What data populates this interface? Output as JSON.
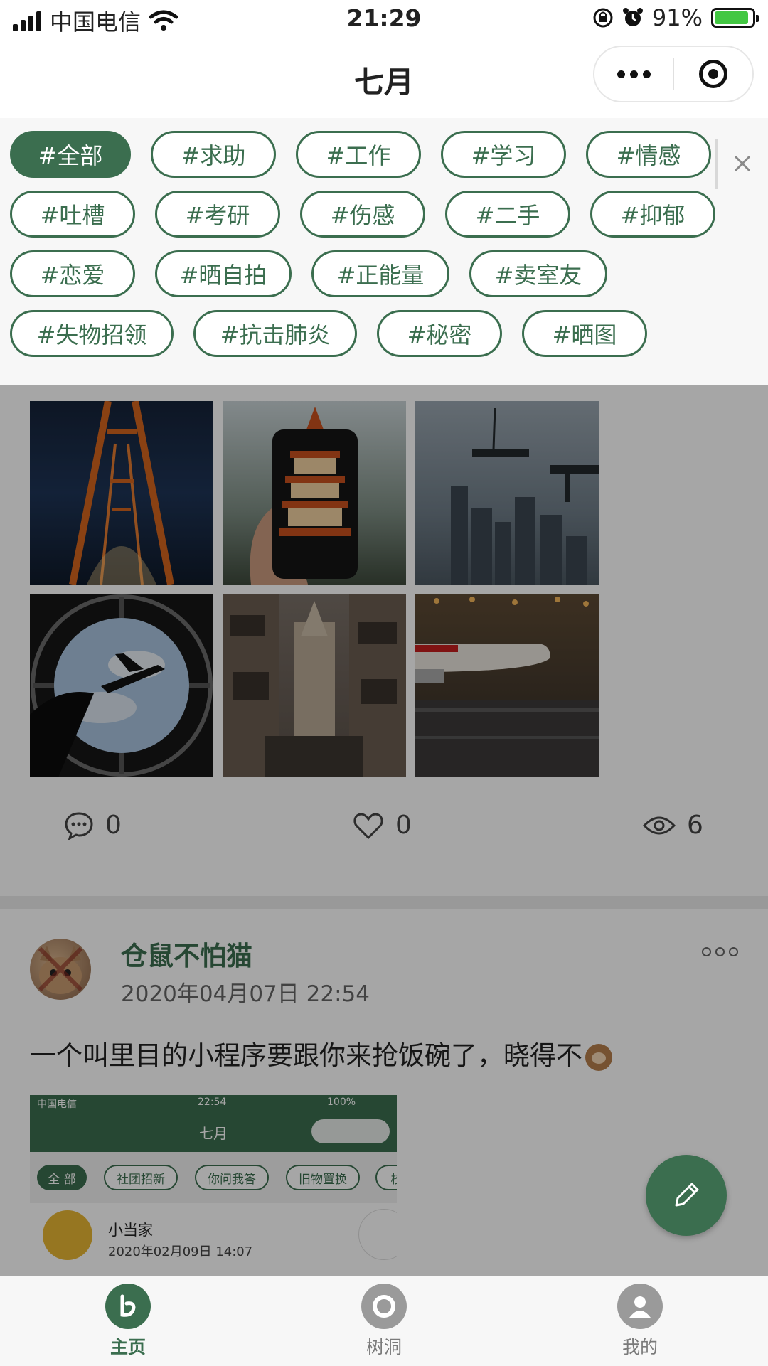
{
  "status_bar": {
    "carrier": "中国电信",
    "time": "21:29",
    "battery": "91%",
    "battery_level": 0.91
  },
  "nav": {
    "title": "七月"
  },
  "tags": [
    {
      "label": "#全部",
      "active": true
    },
    {
      "label": "#求助"
    },
    {
      "label": "#工作"
    },
    {
      "label": "#学习"
    },
    {
      "label": "#情感"
    },
    {
      "label": "#吐槽"
    },
    {
      "label": "#考研"
    },
    {
      "label": "#伤感"
    },
    {
      "label": "#二手"
    },
    {
      "label": "#抑郁"
    },
    {
      "label": "#恋爱"
    },
    {
      "label": "#晒自拍"
    },
    {
      "label": "#正能量"
    },
    {
      "label": "#卖室友"
    },
    {
      "label": "#失物招领"
    },
    {
      "label": "#抗击肺炎"
    },
    {
      "label": "#秘密"
    },
    {
      "label": "#晒图"
    }
  ],
  "post1": {
    "comments": "0",
    "likes": "0",
    "views": "6"
  },
  "post2": {
    "author": "仓鼠不怕猫",
    "time": "2020年04月07日 22:54",
    "text": "一个叫里目的小程序要跟你来抢饭碗了，晓得不",
    "screenshot": {
      "carrier": "中国电信",
      "time": "22:54",
      "battery": "100%",
      "title": "七月",
      "tags": [
        "全 部",
        "社团招新",
        "你问我答",
        "旧物置换",
        "校"
      ],
      "author": "小当家",
      "date": "2020年02月09日 14:07"
    }
  },
  "tabbar": [
    {
      "label": "主页",
      "active": true
    },
    {
      "label": "树洞"
    },
    {
      "label": "我的"
    }
  ],
  "colors": {
    "accent": "#3b6e4f",
    "overlay": "rgba(0,0,0,0.35)"
  }
}
